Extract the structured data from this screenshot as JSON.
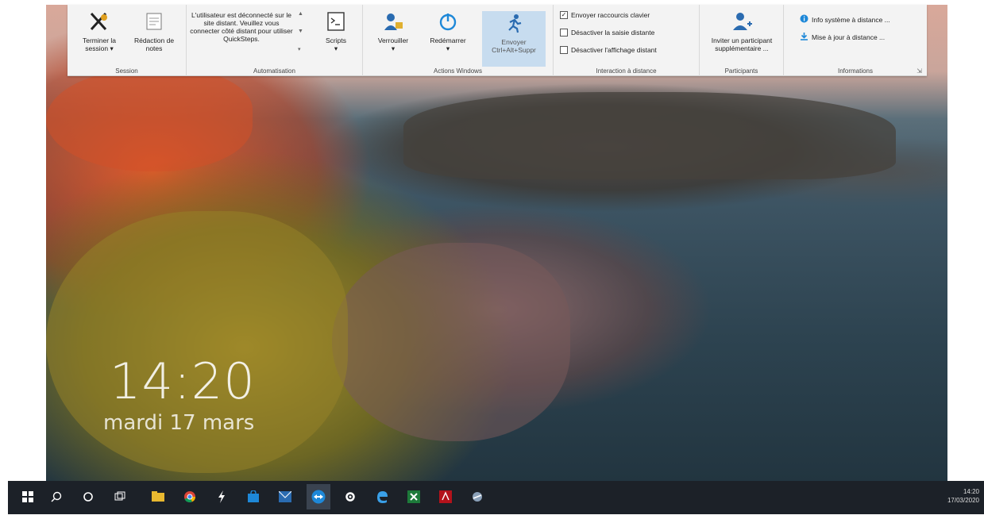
{
  "ribbon": {
    "session": {
      "group_label": "Session",
      "end_session": "Terminer la session ▾",
      "notes": "Rédaction de notes"
    },
    "automation": {
      "group_label": "Automatisation",
      "notice": "L'utilisateur est déconnecté sur le site distant. Veuillez vous connecter côté distant pour utiliser QuickSteps.",
      "scripts": "Scripts"
    },
    "windows_actions": {
      "group_label": "Actions Windows",
      "lock": "Verrouiller",
      "restart": "Redémarrer",
      "send": "Envoyer Ctrl+Alt+Suppr"
    },
    "remote_interaction": {
      "group_label": "Interaction à distance",
      "send_shortcuts": "Envoyer raccourcis clavier",
      "disable_input": "Désactiver la saisie distante",
      "disable_display": "Désactiver l'affichage distant"
    },
    "participants": {
      "group_label": "Participants",
      "invite": "Inviter un participant supplémentaire ..."
    },
    "information": {
      "group_label": "Informations",
      "system_info": "Info système à distance ...",
      "remote_update": "Mise à jour à distance ..."
    }
  },
  "lockscreen": {
    "time": "14:20",
    "date": "mardi 17 mars"
  },
  "tray": {
    "time": "14:20",
    "date": "17/03/2020"
  },
  "colors": {
    "accent": "#1e88d8",
    "taskbar": "#1c2128"
  },
  "taskbar_icons": [
    "start-icon",
    "search-icon",
    "cortana-icon",
    "task-view-icon",
    "file-explorer-icon",
    "chrome-icon",
    "app-icon",
    "store-icon",
    "mail-icon",
    "teamviewer-icon",
    "settings-icon",
    "edge-icon",
    "excel-icon",
    "acrobat-icon",
    "network-icon"
  ]
}
